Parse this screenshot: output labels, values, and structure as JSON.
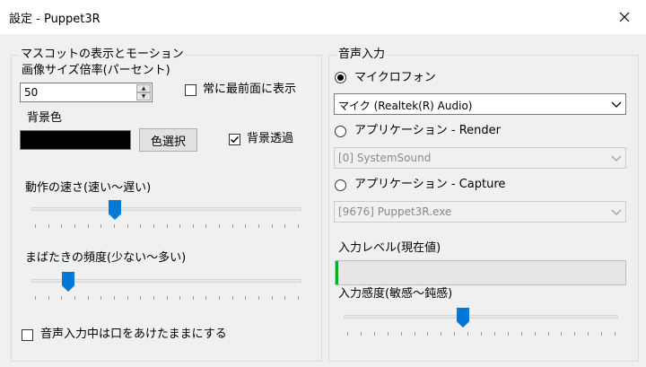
{
  "window": {
    "title": "設定 - Puppet3R"
  },
  "mascot": {
    "legend": "マスコットの表示とモーション",
    "scale_label": "画像サイズ倍率(パーセント)",
    "scale_value": "50",
    "always_on_top": {
      "label": "常に最前面に表示",
      "checked": false
    },
    "bg_color_label": "背景色",
    "bg_color_value": "#000000",
    "color_select_button": "色選択",
    "bg_transparent": {
      "label": "背景透過",
      "checked": true
    },
    "speed": {
      "label": "動作の速さ(速い～遅い)",
      "value": 0.3
    },
    "blink": {
      "label": "まばたきの頻度(少ない～多い)",
      "value": 0.12
    },
    "mouth_open": {
      "label": "音声入力中は口をあけたままにする",
      "checked": false
    }
  },
  "audio": {
    "legend": "音声入力",
    "microphone": {
      "label": "マイクロフォン",
      "selected": true,
      "device": "マイク (Realtek(R) Audio)"
    },
    "render": {
      "label": "アプリケーション - Render",
      "selected": false,
      "device": "[0] SystemSound"
    },
    "capture": {
      "label": "アプリケーション - Capture",
      "selected": false,
      "device": "[9676] Puppet3R.exe"
    },
    "level_label": "入力レベル(現在値)",
    "level_value": 0.01,
    "sensitivity": {
      "label": "入力感度(敏感～鈍感)",
      "value": 0.43
    }
  },
  "colors": {
    "accent": "#0078d7",
    "level": "#06b025"
  }
}
